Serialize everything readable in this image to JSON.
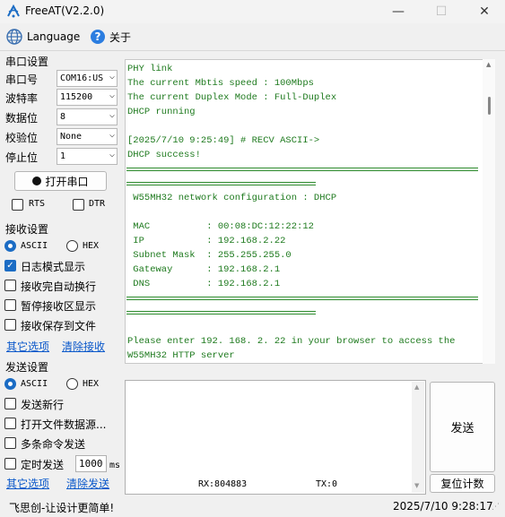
{
  "window": {
    "title": "FreeAT(V2.2.0)",
    "minimize": "—",
    "maximize": "☐",
    "close": "✕"
  },
  "toolbar": {
    "language": "Language",
    "about": "关于"
  },
  "serial": {
    "section": "串口设置",
    "port_label": "串口号",
    "port_value": "COM16:US",
    "baud_label": "波特率",
    "baud_value": "115200",
    "data_label": "数据位",
    "data_value": "8",
    "parity_label": "校验位",
    "parity_value": "None",
    "stop_label": "停止位",
    "stop_value": "1",
    "open_button": "打开串口",
    "rts": "RTS",
    "dtr": "DTR"
  },
  "receive": {
    "section": "接收设置",
    "ascii": "ASCII",
    "hex": "HEX",
    "log_mode": "日志模式显示",
    "log_mode_checked": true,
    "auto_newline": "接收完自动换行",
    "pause": "暂停接收区显示",
    "save_file": "接收保存到文件",
    "more": "其它选项",
    "clear": "清除接收"
  },
  "send": {
    "section": "发送设置",
    "ascii": "ASCII",
    "hex": "HEX",
    "newline": "发送新行",
    "file_source": "打开文件数据源...",
    "multi_cmd": "多条命令发送",
    "timed": "定时发送",
    "interval": "1000",
    "unit": "ms",
    "more": "其它选项",
    "clear": "清除发送",
    "send_button": "发送",
    "reset_count": "复位计数"
  },
  "terminal": {
    "lines": [
      "PHY link",
      "The current Mbtis speed : 100Mbps",
      "The current Duplex Mode : Full-Duplex",
      "DHCP running",
      "",
      "[2025/7/10 9:25:49] # RECV ASCII->",
      "DHCP success!"
    ],
    "config_title": " W55MH32 network configuration : DHCP",
    "config": [
      " MAC          : 00:08:DC:12:22:12",
      " IP           : 192.168.2.22",
      " Subnet Mask  : 255.255.255.0",
      " Gateway      : 192.168.2.1",
      " DNS          : 192.168.2.1"
    ],
    "tail": [
      "Please enter 192. 168. 2. 22 in your browser to access the",
      "W55MH32 HTTP server"
    ]
  },
  "counters": {
    "rx": "RX:804883",
    "tx": "TX:0"
  },
  "status": {
    "left": "飞思创-让设计更简单!",
    "right": "2025/7/10 9:28:17"
  },
  "colors": {
    "terminal_text": "#1e7a1e",
    "accent": "#1b6cc4",
    "link": "#0a58ca"
  },
  "icons": {
    "app": "app-logo-icon",
    "language": "globe-icon",
    "about": "help-icon"
  }
}
